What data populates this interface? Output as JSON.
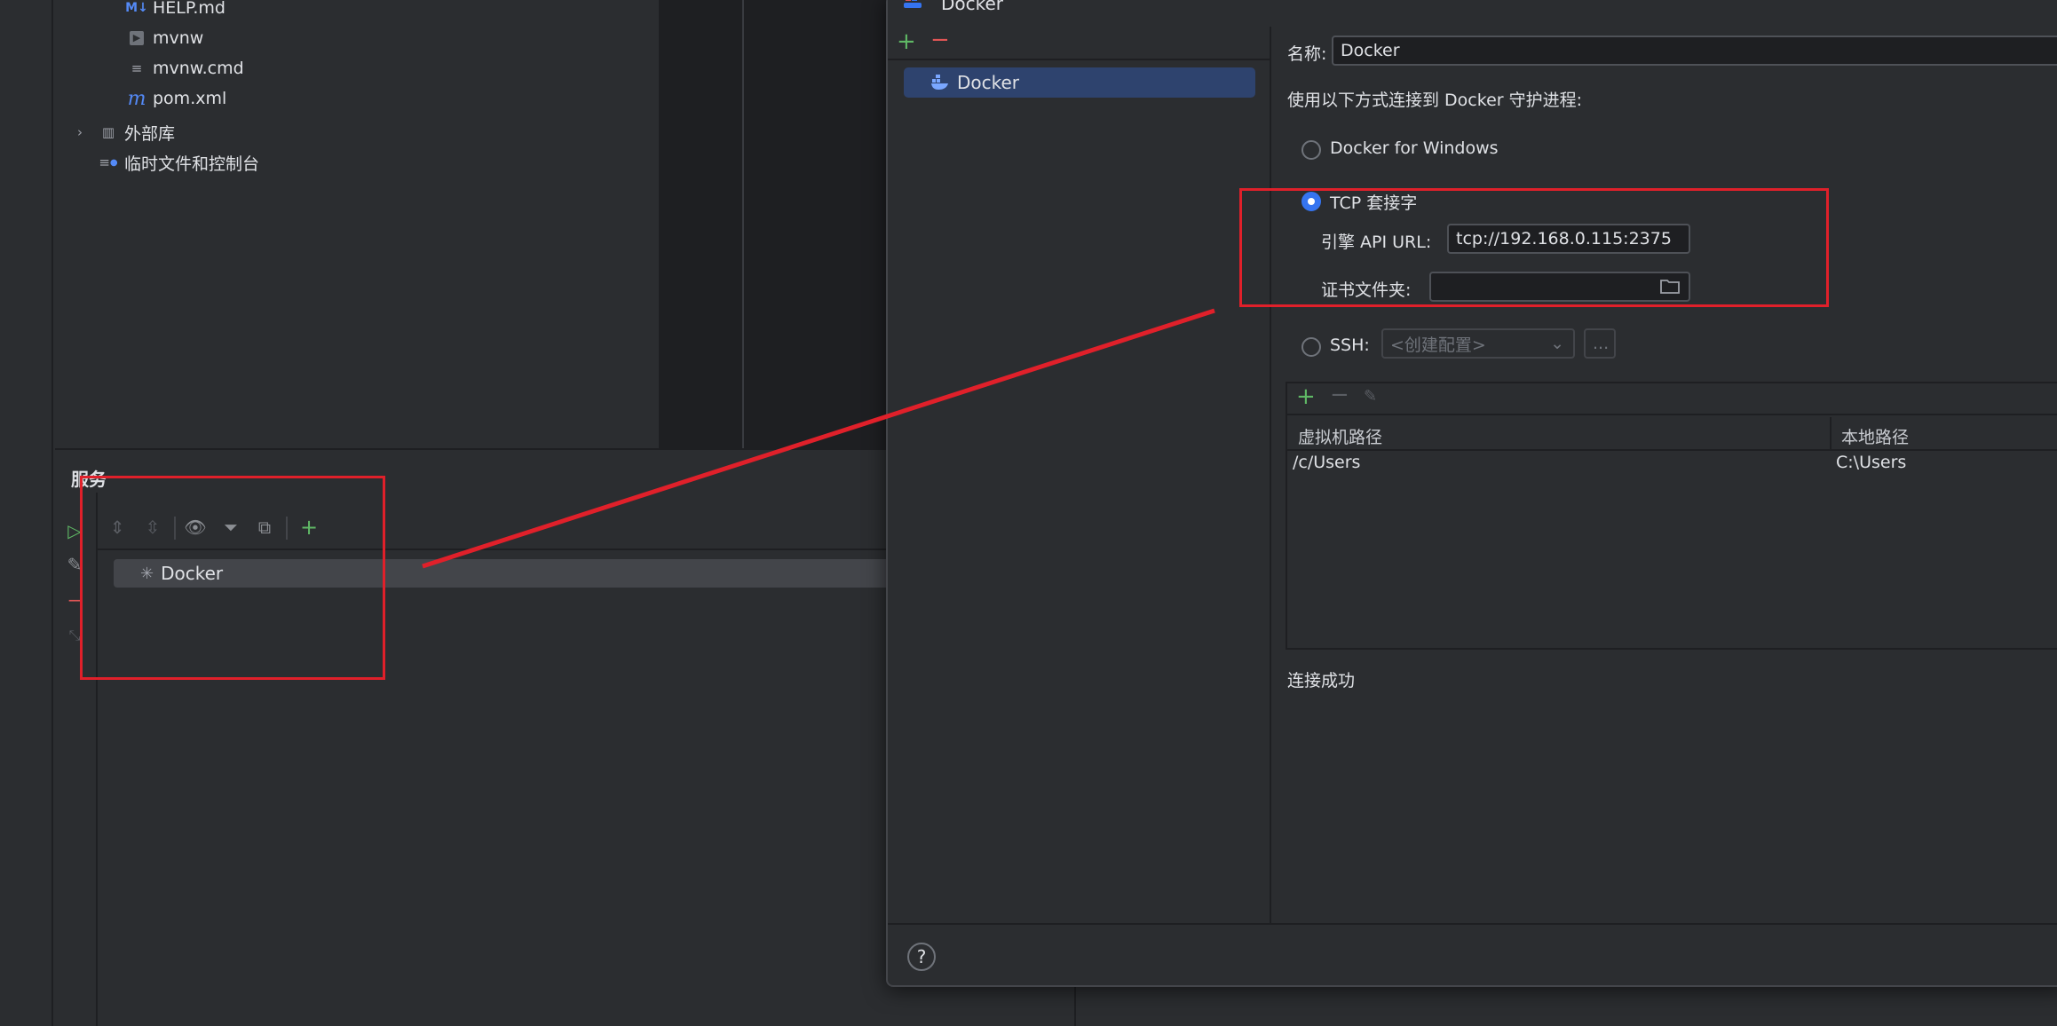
{
  "project_tree": {
    "items": [
      {
        "icon": "markdown-file-icon",
        "label": "HELP.md"
      },
      {
        "icon": "script-file-icon",
        "label": "mvnw"
      },
      {
        "icon": "text-file-icon",
        "label": "mvnw.cmd"
      },
      {
        "icon": "maven-file-icon",
        "label": "pom.xml"
      },
      {
        "icon": "library-icon",
        "label": "外部库"
      },
      {
        "icon": "scratches-icon",
        "label": "临时文件和控制台"
      }
    ]
  },
  "services": {
    "title": "服务",
    "tree_item": "Docker"
  },
  "dialog": {
    "title": "Docker",
    "list_item": "Docker",
    "name_label": "名称:",
    "name_value": "Docker",
    "connect_label": "使用以下方式连接到 Docker 守护进程:",
    "opt_windows": "Docker for Windows",
    "opt_tcp": "TCP 套接字",
    "api_url_label": "引擎 API URL:",
    "api_url_value": "tcp://192.168.0.115:2375",
    "cert_label": "证书文件夹:",
    "cert_value": "",
    "opt_ssh": "SSH:",
    "ssh_placeholder": "<创建配置>",
    "ssh_more": "...",
    "table": {
      "headers": [
        "虚拟机路径",
        "本地路径"
      ],
      "rows": [
        [
          "/c/Users",
          "C:\\Users"
        ]
      ]
    },
    "status": "连接成功",
    "help": "?"
  },
  "colors": {
    "accent": "#3574f0",
    "annotation": "#e0202a",
    "add": "#5fb865",
    "remove": "#e05555"
  }
}
